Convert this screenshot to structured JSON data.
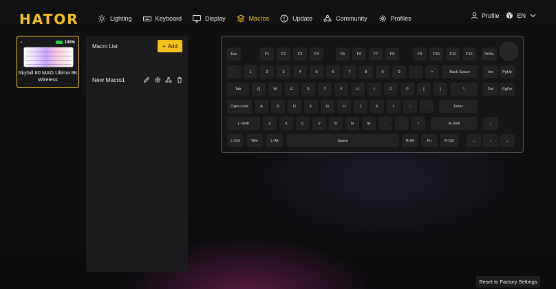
{
  "app": {
    "logo": "HATOR"
  },
  "nav": [
    {
      "id": "lighting",
      "label": "Lighting",
      "icon": "sun-icon",
      "active": false
    },
    {
      "id": "keyboard",
      "label": "Keyboard",
      "icon": "keyboard-icon",
      "active": false
    },
    {
      "id": "display",
      "label": "Display",
      "icon": "monitor-icon",
      "active": false
    },
    {
      "id": "macros",
      "label": "Macros",
      "icon": "layers-icon",
      "active": true
    },
    {
      "id": "update",
      "label": "Update",
      "icon": "update-icon",
      "active": false
    },
    {
      "id": "community",
      "label": "Community",
      "icon": "community-icon",
      "active": false
    },
    {
      "id": "profiles",
      "label": "Profiles",
      "icon": "gear-icon",
      "active": false
    }
  ],
  "top_right": {
    "profile_label": "Profile",
    "language": "EN"
  },
  "device": {
    "name": "Skyfall 80 MAG Ultima 8K Wireless",
    "battery": "100%"
  },
  "macros": {
    "title": "Macro List",
    "add_label": "Add",
    "items": [
      {
        "name": "New Macro1"
      }
    ]
  },
  "keyboard": {
    "keys": [
      "Esc",
      "F1",
      "F2",
      "F3",
      "F4",
      "F5",
      "F6",
      "F7",
      "F8",
      "F9",
      "F10",
      "F11",
      "F12",
      "PrtSc",
      "`",
      "1",
      "2",
      "3",
      "4",
      "5",
      "6",
      "7",
      "8",
      "9",
      "0",
      "-",
      "=",
      "Back Space",
      "Ins",
      "PgUp",
      "Tab",
      "Q",
      "W",
      "E",
      "R",
      "T",
      "Y",
      "U",
      "I",
      "O",
      "P",
      "[",
      "]",
      "\\",
      "Del",
      "PgDn",
      "Caps Lock",
      "A",
      "S",
      "D",
      "F",
      "G",
      "H",
      "J",
      "K",
      "L",
      ";",
      "'",
      "Enter",
      "L-Shift",
      "Z",
      "X",
      "C",
      "V",
      "B",
      "N",
      "M",
      ",",
      ".",
      "/",
      "R-Shift",
      "↑",
      "L-Ctrl",
      "Win",
      "L-Alt",
      "Space",
      "R-Alt",
      "Fn",
      "R-Ctrl",
      "←",
      "↓",
      "→"
    ]
  },
  "footer": {
    "reset_label": "Reset to Factory Settings"
  },
  "colors": {
    "accent": "#f2c11a",
    "panel": "#1c1c1e",
    "key": "#222225"
  }
}
